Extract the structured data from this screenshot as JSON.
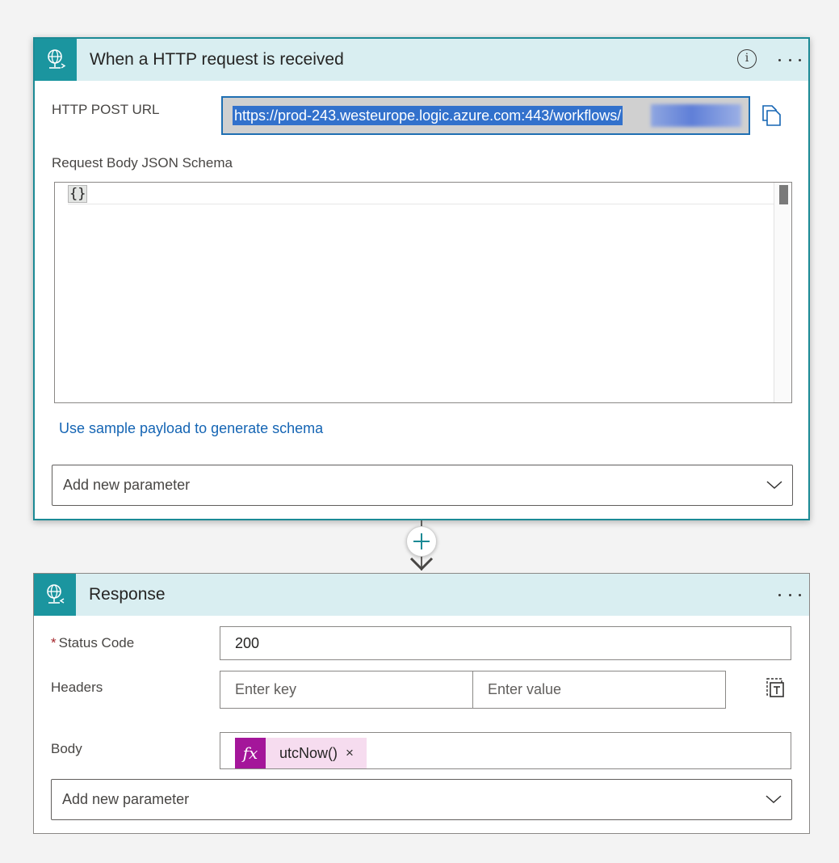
{
  "trigger": {
    "title": "When a HTTP request is received",
    "info_icon": "info-icon",
    "more_icon": "more-options-icon",
    "url_label": "HTTP POST URL",
    "url_value": "https://prod-243.westeurope.logic.azure.com:443/workflows/",
    "copy_icon": "copy-icon",
    "schema_label": "Request Body JSON Schema",
    "schema_value": "{}",
    "sample_link": "Use sample payload to generate schema",
    "add_param": "Add new parameter"
  },
  "connector": {
    "add_icon": "plus-icon",
    "arrow_icon": "arrow-down-icon"
  },
  "response": {
    "title": "Response",
    "more_icon": "more-options-icon",
    "required_marker": "*",
    "status_label": "Status Code",
    "status_value": "200",
    "headers_label": "Headers",
    "key_placeholder": "Enter key",
    "value_placeholder": "Enter value",
    "text_mode_icon": "switch-to-text-mode-icon",
    "body_label": "Body",
    "token_fx": "fx",
    "token_text": "utcNow()",
    "token_remove": "×",
    "add_param": "Add new parameter"
  },
  "colors": {
    "accent": "#1b959f",
    "header_bg": "#d9eef1",
    "link": "#1565b4",
    "token_bg": "#f6dcef",
    "token_fx_bg": "#a4169a",
    "selection": "#3271cc"
  }
}
